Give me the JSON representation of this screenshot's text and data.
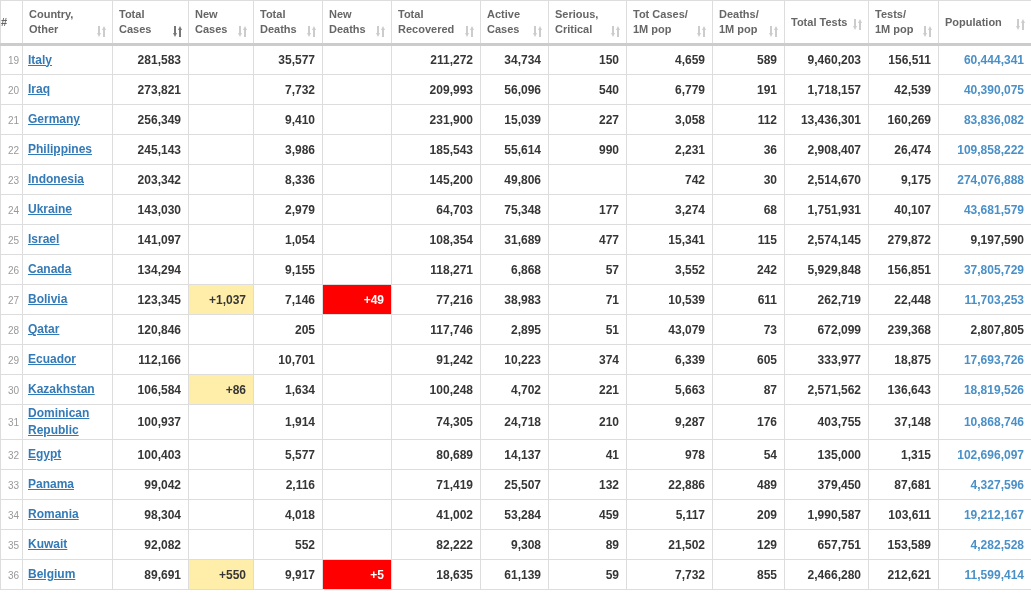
{
  "columns": [
    {
      "label": "#",
      "sortable": false
    },
    {
      "label": "Country, Other",
      "sortable": true,
      "sorted": false
    },
    {
      "label": "Total Cases",
      "sortable": true,
      "sorted": true
    },
    {
      "label": "New Cases",
      "sortable": true,
      "sorted": false
    },
    {
      "label": "Total Deaths",
      "sortable": true,
      "sorted": false
    },
    {
      "label": "New Deaths",
      "sortable": true,
      "sorted": false
    },
    {
      "label": "Total Recovered",
      "sortable": true,
      "sorted": false
    },
    {
      "label": "Active Cases",
      "sortable": true,
      "sorted": false
    },
    {
      "label": "Serious, Critical",
      "sortable": true,
      "sorted": false
    },
    {
      "label": "Tot Cases/ 1M pop",
      "sortable": true,
      "sorted": false
    },
    {
      "label": "Deaths/ 1M pop",
      "sortable": true,
      "sorted": false
    },
    {
      "label": "Total Tests",
      "sortable": true,
      "sorted": false
    },
    {
      "label": "Tests/ 1M pop",
      "sortable": true,
      "sorted": false
    },
    {
      "label": "Population",
      "sortable": true,
      "sorted": false
    }
  ],
  "rows": [
    {
      "rank": "19",
      "country": "Italy",
      "total_cases": "281,583",
      "total_deaths": "35,577",
      "total_recovered": "211,272",
      "active_cases": "34,734",
      "serious_critical": "150",
      "tot_cases_per_1m": "4,659",
      "deaths_per_1m": "589",
      "total_tests": "9,460,203",
      "tests_per_1m": "156,511",
      "population": "60,444,341",
      "population_linked": true
    },
    {
      "rank": "20",
      "country": "Iraq",
      "total_cases": "273,821",
      "total_deaths": "7,732",
      "total_recovered": "209,993",
      "active_cases": "56,096",
      "serious_critical": "540",
      "tot_cases_per_1m": "6,779",
      "deaths_per_1m": "191",
      "total_tests": "1,718,157",
      "tests_per_1m": "42,539",
      "population": "40,390,075",
      "population_linked": true
    },
    {
      "rank": "21",
      "country": "Germany",
      "total_cases": "256,349",
      "total_deaths": "9,410",
      "total_recovered": "231,900",
      "active_cases": "15,039",
      "serious_critical": "227",
      "tot_cases_per_1m": "3,058",
      "deaths_per_1m": "112",
      "total_tests": "13,436,301",
      "tests_per_1m": "160,269",
      "population": "83,836,082",
      "population_linked": true
    },
    {
      "rank": "22",
      "country": "Philippines",
      "total_cases": "245,143",
      "total_deaths": "3,986",
      "total_recovered": "185,543",
      "active_cases": "55,614",
      "serious_critical": "990",
      "tot_cases_per_1m": "2,231",
      "deaths_per_1m": "36",
      "total_tests": "2,908,407",
      "tests_per_1m": "26,474",
      "population": "109,858,222",
      "population_linked": true
    },
    {
      "rank": "23",
      "country": "Indonesia",
      "total_cases": "203,342",
      "total_deaths": "8,336",
      "total_recovered": "145,200",
      "active_cases": "49,806",
      "tot_cases_per_1m": "742",
      "deaths_per_1m": "30",
      "total_tests": "2,514,670",
      "tests_per_1m": "9,175",
      "population": "274,076,888",
      "population_linked": true
    },
    {
      "rank": "24",
      "country": "Ukraine",
      "total_cases": "143,030",
      "total_deaths": "2,979",
      "total_recovered": "64,703",
      "active_cases": "75,348",
      "serious_critical": "177",
      "tot_cases_per_1m": "3,274",
      "deaths_per_1m": "68",
      "total_tests": "1,751,931",
      "tests_per_1m": "40,107",
      "population": "43,681,579",
      "population_linked": true
    },
    {
      "rank": "25",
      "country": "Israel",
      "total_cases": "141,097",
      "total_deaths": "1,054",
      "total_recovered": "108,354",
      "active_cases": "31,689",
      "serious_critical": "477",
      "tot_cases_per_1m": "15,341",
      "deaths_per_1m": "115",
      "total_tests": "2,574,145",
      "tests_per_1m": "279,872",
      "population": "9,197,590",
      "population_linked": false
    },
    {
      "rank": "26",
      "country": "Canada",
      "total_cases": "134,294",
      "total_deaths": "9,155",
      "total_recovered": "118,271",
      "active_cases": "6,868",
      "serious_critical": "57",
      "tot_cases_per_1m": "3,552",
      "deaths_per_1m": "242",
      "total_tests": "5,929,848",
      "tests_per_1m": "156,851",
      "population": "37,805,729",
      "population_linked": true
    },
    {
      "rank": "27",
      "country": "Bolivia",
      "total_cases": "123,345",
      "new_cases": "+1,037",
      "total_deaths": "7,146",
      "new_deaths": "+49",
      "total_recovered": "77,216",
      "active_cases": "38,983",
      "serious_critical": "71",
      "tot_cases_per_1m": "10,539",
      "deaths_per_1m": "611",
      "total_tests": "262,719",
      "tests_per_1m": "22,448",
      "population": "11,703,253",
      "population_linked": true
    },
    {
      "rank": "28",
      "country": "Qatar",
      "total_cases": "120,846",
      "total_deaths": "205",
      "total_recovered": "117,746",
      "active_cases": "2,895",
      "serious_critical": "51",
      "tot_cases_per_1m": "43,079",
      "deaths_per_1m": "73",
      "total_tests": "672,099",
      "tests_per_1m": "239,368",
      "population": "2,807,805",
      "population_linked": false
    },
    {
      "rank": "29",
      "country": "Ecuador",
      "total_cases": "112,166",
      "total_deaths": "10,701",
      "total_recovered": "91,242",
      "active_cases": "10,223",
      "serious_critical": "374",
      "tot_cases_per_1m": "6,339",
      "deaths_per_1m": "605",
      "total_tests": "333,977",
      "tests_per_1m": "18,875",
      "population": "17,693,726",
      "population_linked": true
    },
    {
      "rank": "30",
      "country": "Kazakhstan",
      "total_cases": "106,584",
      "new_cases": "+86",
      "total_deaths": "1,634",
      "total_recovered": "100,248",
      "active_cases": "4,702",
      "serious_critical": "221",
      "tot_cases_per_1m": "5,663",
      "deaths_per_1m": "87",
      "total_tests": "2,571,562",
      "tests_per_1m": "136,643",
      "population": "18,819,526",
      "population_linked": true
    },
    {
      "rank": "31",
      "country": "Dominican Republic",
      "total_cases": "100,937",
      "total_deaths": "1,914",
      "total_recovered": "74,305",
      "active_cases": "24,718",
      "serious_critical": "210",
      "tot_cases_per_1m": "9,287",
      "deaths_per_1m": "176",
      "total_tests": "403,755",
      "tests_per_1m": "37,148",
      "population": "10,868,746",
      "population_linked": true
    },
    {
      "rank": "32",
      "country": "Egypt",
      "total_cases": "100,403",
      "total_deaths": "5,577",
      "total_recovered": "80,689",
      "active_cases": "14,137",
      "serious_critical": "41",
      "tot_cases_per_1m": "978",
      "deaths_per_1m": "54",
      "total_tests": "135,000",
      "tests_per_1m": "1,315",
      "population": "102,696,097",
      "population_linked": true
    },
    {
      "rank": "33",
      "country": "Panama",
      "total_cases": "99,042",
      "total_deaths": "2,116",
      "total_recovered": "71,419",
      "active_cases": "25,507",
      "serious_critical": "132",
      "tot_cases_per_1m": "22,886",
      "deaths_per_1m": "489",
      "total_tests": "379,450",
      "tests_per_1m": "87,681",
      "population": "4,327,596",
      "population_linked": true
    },
    {
      "rank": "34",
      "country": "Romania",
      "total_cases": "98,304",
      "total_deaths": "4,018",
      "total_recovered": "41,002",
      "active_cases": "53,284",
      "serious_critical": "459",
      "tot_cases_per_1m": "5,117",
      "deaths_per_1m": "209",
      "total_tests": "1,990,587",
      "tests_per_1m": "103,611",
      "population": "19,212,167",
      "population_linked": true
    },
    {
      "rank": "35",
      "country": "Kuwait",
      "total_cases": "92,082",
      "total_deaths": "552",
      "total_recovered": "82,222",
      "active_cases": "9,308",
      "serious_critical": "89",
      "tot_cases_per_1m": "21,502",
      "deaths_per_1m": "129",
      "total_tests": "657,751",
      "tests_per_1m": "153,589",
      "population": "4,282,528",
      "population_linked": true
    },
    {
      "rank": "36",
      "country": "Belgium",
      "total_cases": "89,691",
      "new_cases": "+550",
      "total_deaths": "9,917",
      "new_deaths": "+5",
      "total_recovered": "18,635",
      "active_cases": "61,139",
      "serious_critical": "59",
      "tot_cases_per_1m": "7,732",
      "deaths_per_1m": "855",
      "total_tests": "2,466,280",
      "tests_per_1m": "212,621",
      "population": "11,599,414",
      "population_linked": true
    }
  ]
}
